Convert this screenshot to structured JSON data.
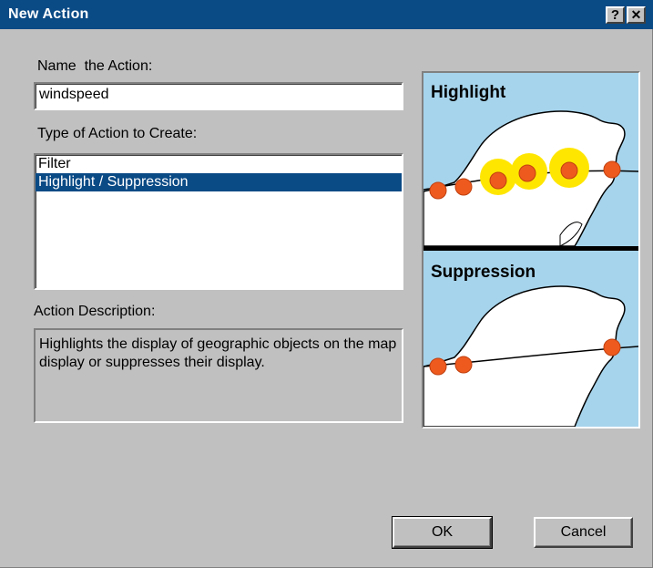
{
  "window": {
    "title": "New Action",
    "help_glyph": "?",
    "close_glyph": "✕"
  },
  "name_field": {
    "label": "Name  the Action:",
    "value": "windspeed"
  },
  "type_list": {
    "label": "Type of Action to Create:",
    "items": [
      "Filter",
      "Highlight / Suppression"
    ],
    "selected": "Highlight / Suppression"
  },
  "description": {
    "label": "Action Description:",
    "text": "Highlights the display of geographic objects on the map display or suppresses their display."
  },
  "preview": {
    "highlight_title": "Highlight",
    "suppression_title": "Suppression"
  },
  "buttons": {
    "ok": "OK",
    "cancel": "Cancel"
  },
  "colors": {
    "titlebar": "#0a4a85",
    "water": "#a6d4ec",
    "storm": "#ee5a1e",
    "glow": "#ffe600"
  }
}
